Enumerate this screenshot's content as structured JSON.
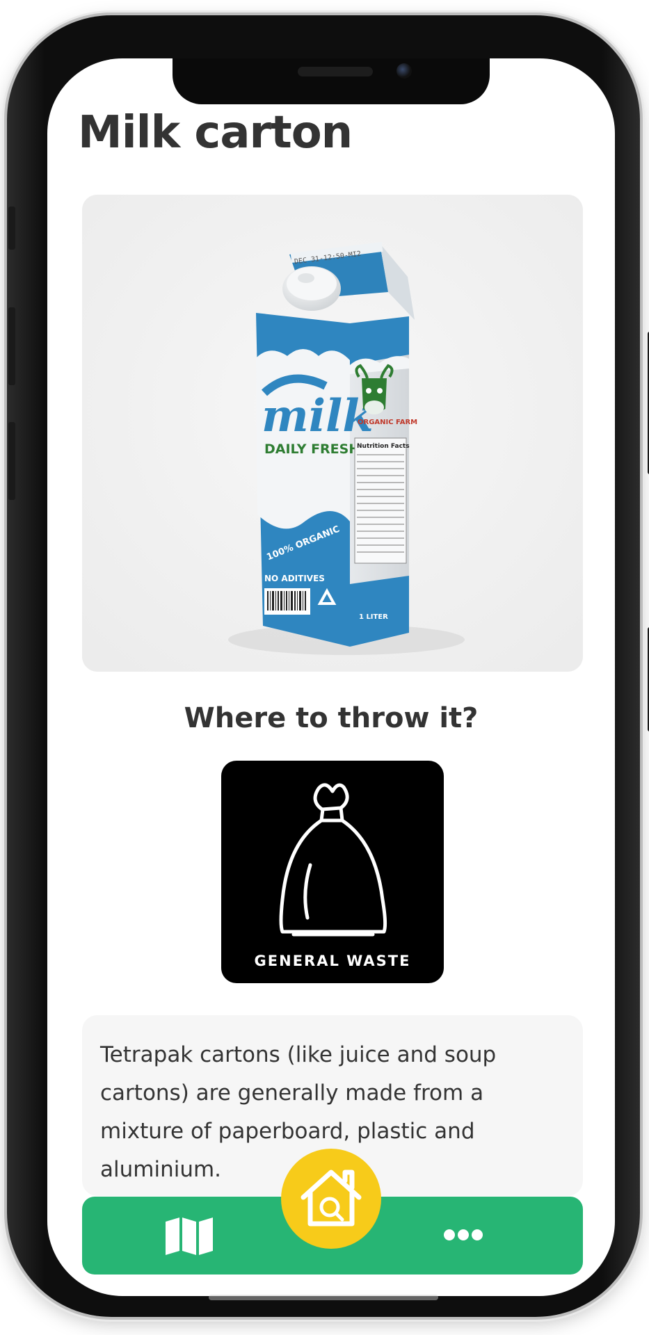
{
  "screen": {
    "title": "Milk carton",
    "question": "Where to throw it?"
  },
  "product_photo": {
    "icon": "milk-carton-photo",
    "carton_brand": "milk",
    "carton_tagline": "DAILY FRESH",
    "carton_badge": "100% ORGANIC",
    "carton_farm": "ORGANIC FARM",
    "carton_side_title": "Nutrition Facts",
    "carton_no_additives": "NO ADITIVES",
    "carton_volume": "1 LITER",
    "carton_date": "DEC 31-12:50-MI2"
  },
  "disposal": {
    "bin_label": "GENERAL WASTE",
    "icon": "trash-bag-icon",
    "tile_color": "#000000"
  },
  "info": {
    "text": "Tetrapak cartons (like juice and soup cartons) are generally made from a mixture of paperboard, plastic and aluminium."
  },
  "nav": {
    "bar_color": "#27b574",
    "home_color": "#f7cb1a",
    "items": [
      {
        "icon": "map-icon"
      },
      {
        "icon": "home-search-icon"
      },
      {
        "icon": "more-dots-icon"
      }
    ]
  }
}
